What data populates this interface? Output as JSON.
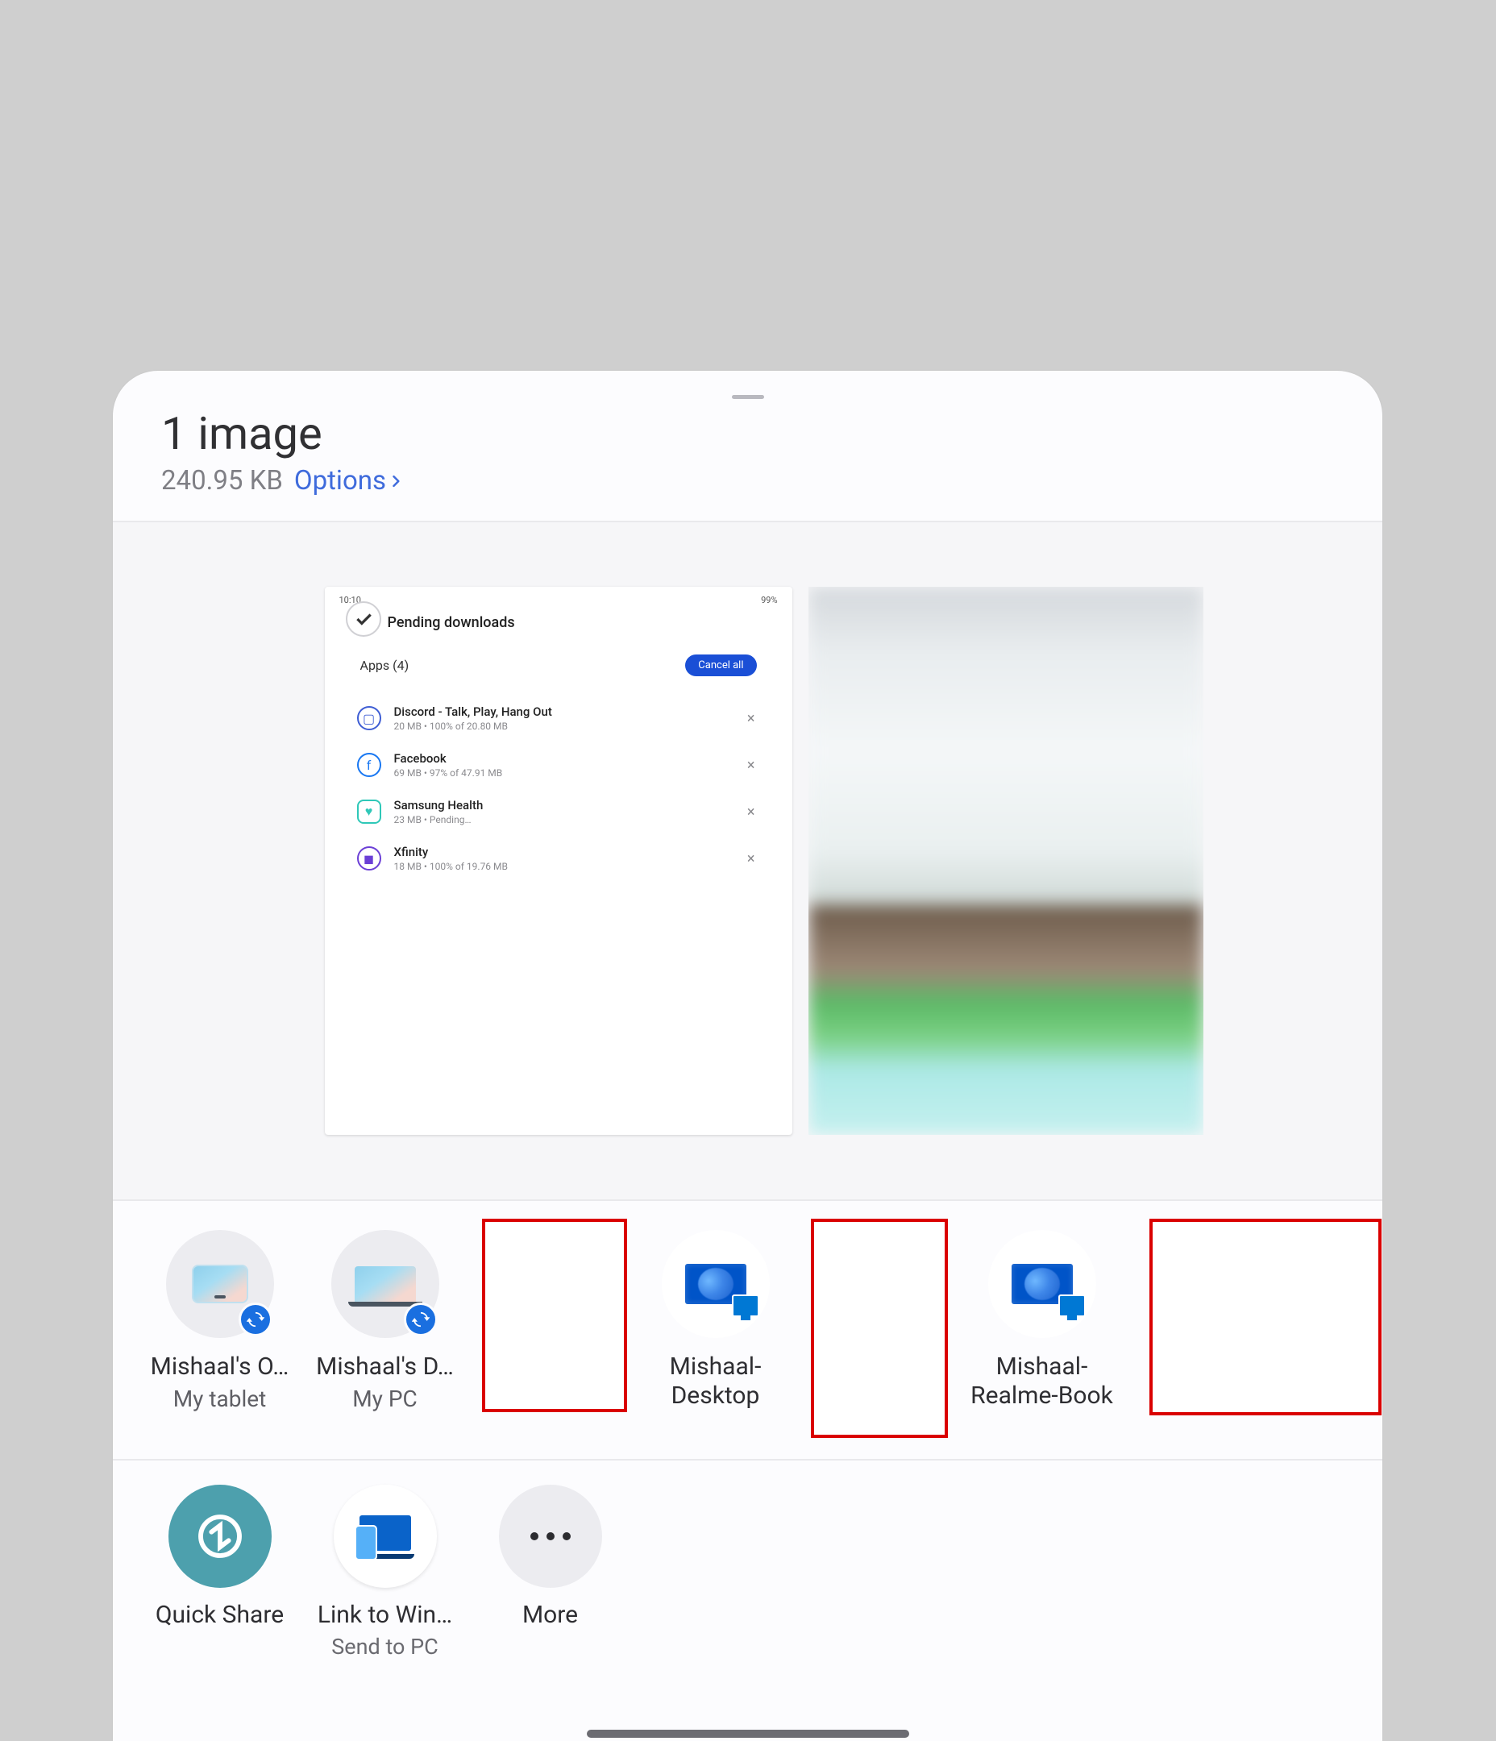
{
  "header": {
    "title": "1 image",
    "filesize": "240.95 KB",
    "options_label": "Options"
  },
  "preview_screenshot": {
    "status_left": "10:10",
    "status_right": "99%",
    "page_title": "Pending downloads",
    "apps_header": "Apps (4)",
    "cancel_all": "Cancel all",
    "items": [
      {
        "name": "Discord - Talk, Play, Hang Out",
        "sub": "20 MB  •  100% of 20.80 MB",
        "color": "#3f5ed4"
      },
      {
        "name": "Facebook",
        "sub": "69 MB  •  97% of 47.91 MB",
        "color": "#1877f2"
      },
      {
        "name": "Samsung Health",
        "sub": "23 MB  •  Pending…",
        "color": "#2fc8b8"
      },
      {
        "name": "Xfinity",
        "sub": "18 MB  •  100% of 19.76 MB",
        "color": "#6b3fd6"
      }
    ]
  },
  "targets": [
    {
      "label": "Mishaal's O…",
      "sub": "My tablet"
    },
    {
      "label": "Mishaal's D…",
      "sub": "My PC"
    },
    {
      "label": "Mishaal-Desktop",
      "sub": ""
    },
    {
      "label": "Mishaal-Realme-Book",
      "sub": ""
    }
  ],
  "actions": {
    "quick_share": "Quick Share",
    "link_to_windows": "Link to Win…",
    "link_to_windows_sub": "Send to PC",
    "more": "More"
  }
}
